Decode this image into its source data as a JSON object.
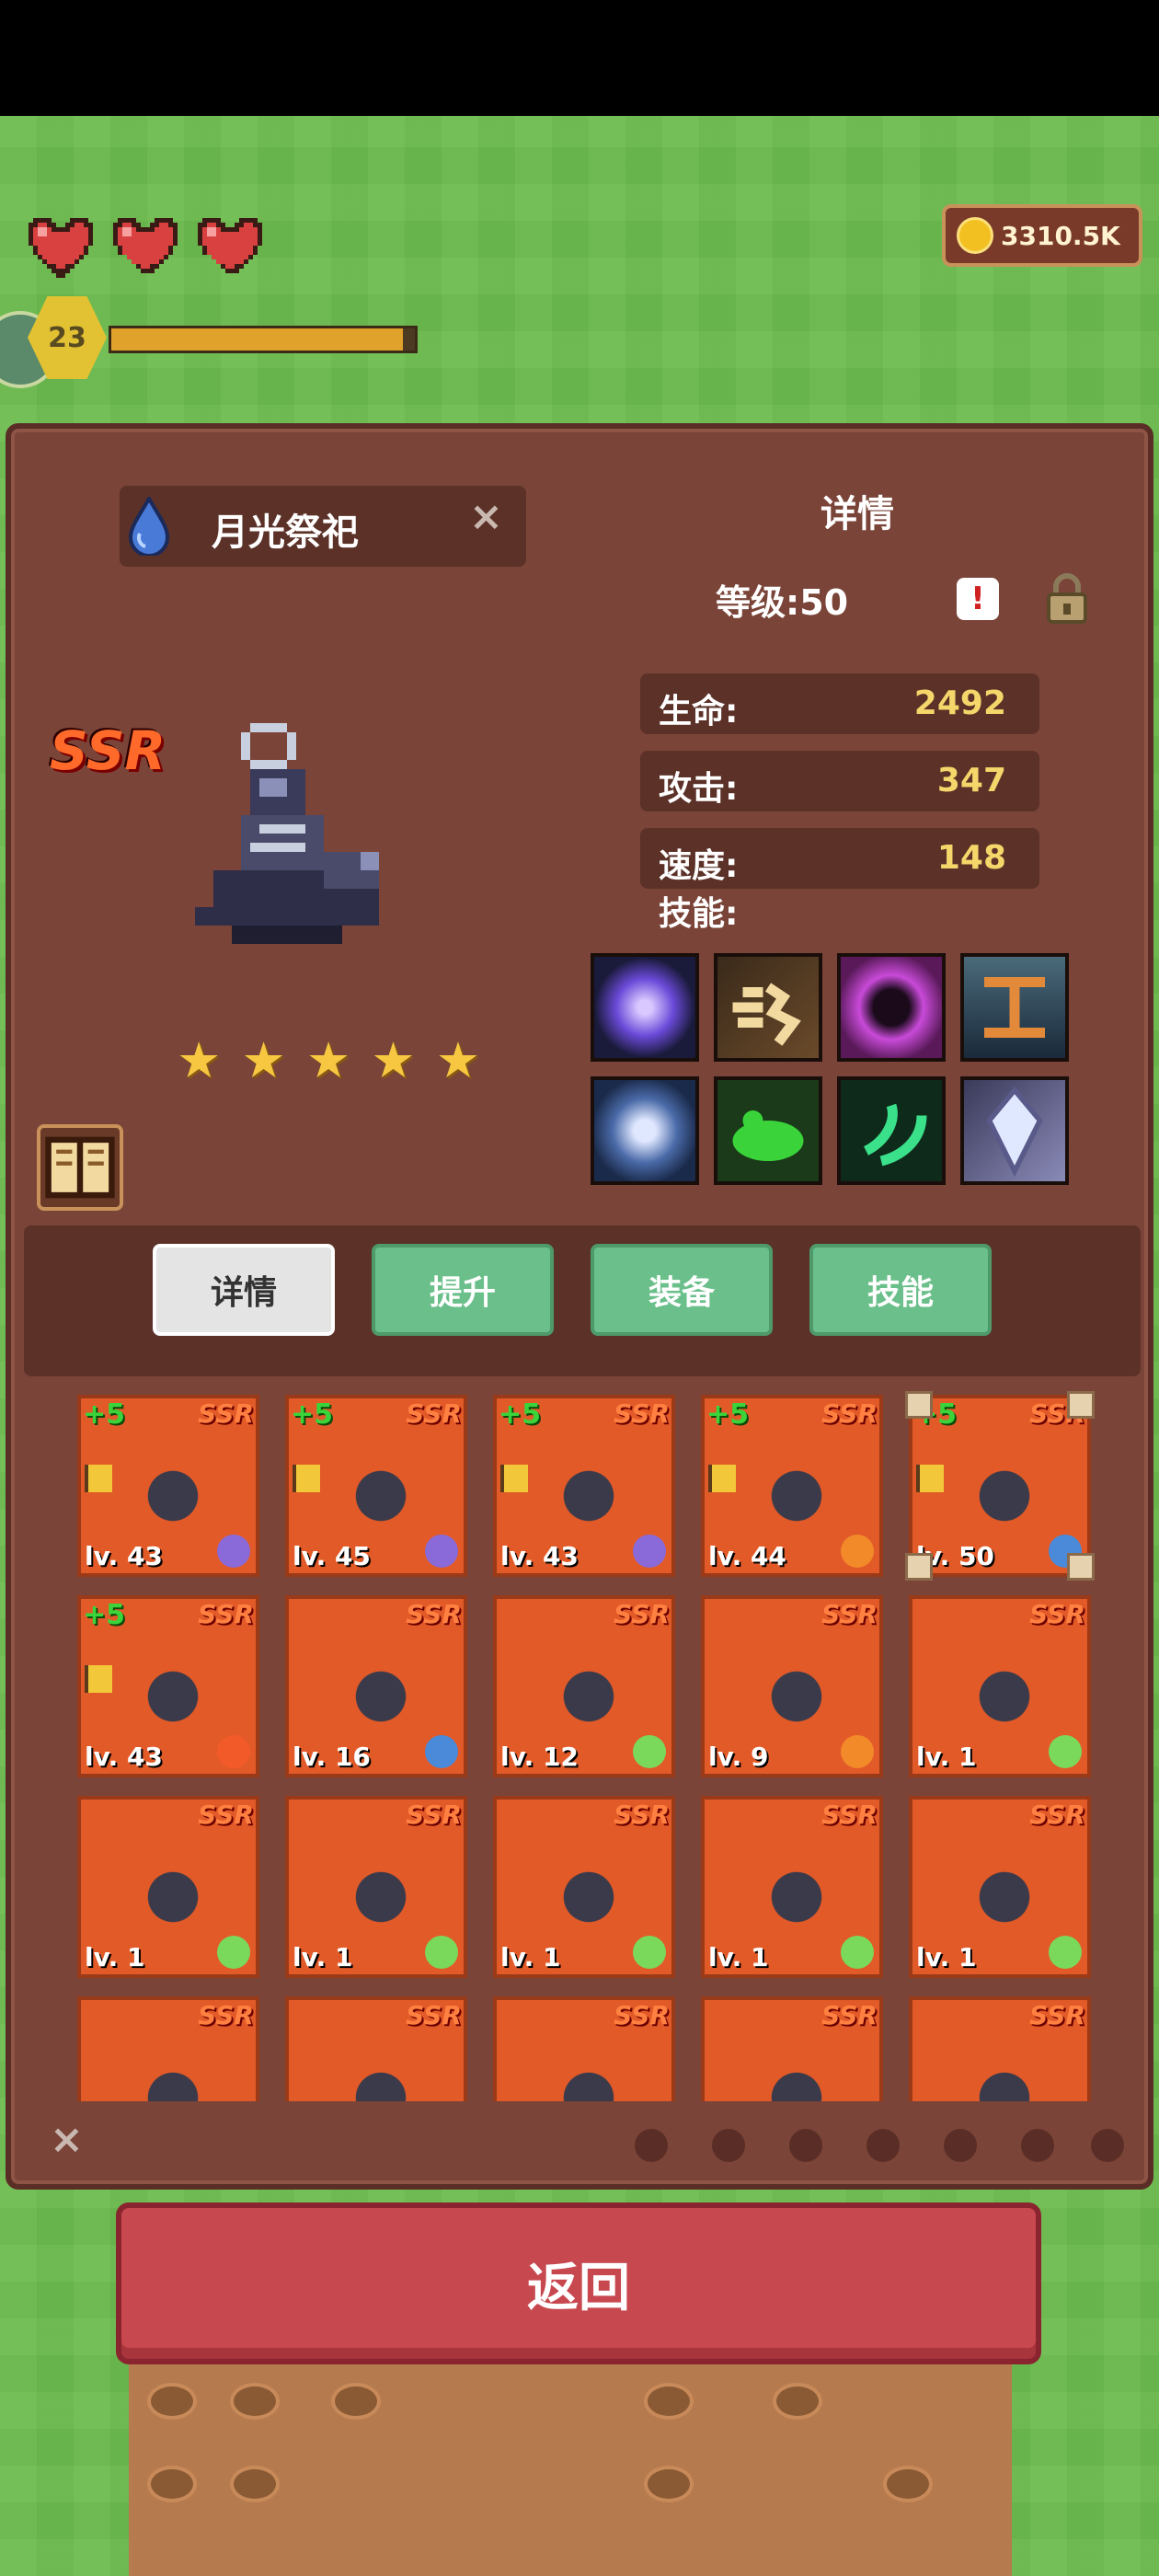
{
  "hud": {
    "hearts": [
      "heart-icon",
      "heart-icon",
      "heart-icon"
    ],
    "coins": "3310.5K",
    "player_level": "23",
    "xp_progress": 0.96
  },
  "hero": {
    "name": "月光祭祀",
    "rarity": "SSR",
    "stars": [
      "★",
      "★",
      "★",
      "★",
      "★"
    ],
    "element_icon": "water-drop-icon"
  },
  "details": {
    "title": "详情",
    "level_label": "等级:50",
    "alert": "!",
    "stats": [
      {
        "label": "生命:",
        "value": "2492"
      },
      {
        "label": "攻击:",
        "value": "347"
      },
      {
        "label": "速度:",
        "value": "148"
      }
    ],
    "skills_label": "技能:",
    "skills": [
      "purple-orb-skill",
      "dash-skill",
      "dark-ring-skill",
      "shrine-skill",
      "spiral-skill",
      "green-slime-skill",
      "green-wind-skill",
      "crystal-skill"
    ]
  },
  "tabs": [
    {
      "label": "详情",
      "active": true
    },
    {
      "label": "提升",
      "active": false
    },
    {
      "label": "装备",
      "active": false
    },
    {
      "label": "技能",
      "active": false
    }
  ],
  "roster": [
    {
      "plus": "+5",
      "rarity": "SSR",
      "level": "lv. 43",
      "flag": true,
      "element": "moon"
    },
    {
      "plus": "+5",
      "rarity": "SSR",
      "level": "lv. 45",
      "flag": true,
      "element": "moon"
    },
    {
      "plus": "+5",
      "rarity": "SSR",
      "level": "lv. 43",
      "flag": true,
      "element": "moon"
    },
    {
      "plus": "+5",
      "rarity": "SSR",
      "level": "lv. 44",
      "flag": true,
      "element": "sun"
    },
    {
      "plus": "+5",
      "rarity": "SSR",
      "level": "lv. 50",
      "flag": true,
      "element": "water",
      "selected": true
    },
    {
      "plus": "+5",
      "rarity": "SSR",
      "level": "lv. 43",
      "flag": true,
      "element": "fire"
    },
    {
      "plus": "",
      "rarity": "SSR",
      "level": "lv. 16",
      "flag": false,
      "element": "water"
    },
    {
      "plus": "",
      "rarity": "SSR",
      "level": "lv. 12",
      "flag": false,
      "element": "leaf"
    },
    {
      "plus": "",
      "rarity": "SSR",
      "level": "lv. 9",
      "flag": false,
      "element": "sun"
    },
    {
      "plus": "",
      "rarity": "SSR",
      "level": "lv. 1",
      "flag": false,
      "element": "leaf"
    },
    {
      "plus": "",
      "rarity": "SSR",
      "level": "lv. 1",
      "flag": false,
      "element": "leaf"
    },
    {
      "plus": "",
      "rarity": "SSR",
      "level": "lv. 1",
      "flag": false,
      "element": "leaf"
    },
    {
      "plus": "",
      "rarity": "SSR",
      "level": "lv. 1",
      "flag": false,
      "element": "leaf"
    },
    {
      "plus": "",
      "rarity": "SSR",
      "level": "lv. 1",
      "flag": false,
      "element": "leaf"
    },
    {
      "plus": "",
      "rarity": "SSR",
      "level": "lv. 1",
      "flag": false,
      "element": "leaf"
    },
    {
      "plus": "",
      "rarity": "SSR",
      "level": "",
      "flag": false,
      "element": ""
    },
    {
      "plus": "",
      "rarity": "SSR",
      "level": "",
      "flag": false,
      "element": ""
    },
    {
      "plus": "",
      "rarity": "SSR",
      "level": "",
      "flag": false,
      "element": ""
    },
    {
      "plus": "",
      "rarity": "SSR",
      "level": "",
      "flag": false,
      "element": ""
    },
    {
      "plus": "",
      "rarity": "SSR",
      "level": "",
      "flag": false,
      "element": ""
    }
  ],
  "filters": [
    "clear-filter-icon",
    "leaf-filter-icon",
    "water-filter-icon",
    "drop-filter-icon",
    "shield-filter-icon",
    "fire-filter-icon",
    "gear-filter-icon",
    "moon-filter-icon"
  ],
  "back_button": "返回",
  "colors": {
    "card": "#e25a28",
    "panel": "#7a4438",
    "tab_active": "#e4e4e4",
    "tab_normal": "#6abf8a",
    "back": "#c8484f"
  }
}
